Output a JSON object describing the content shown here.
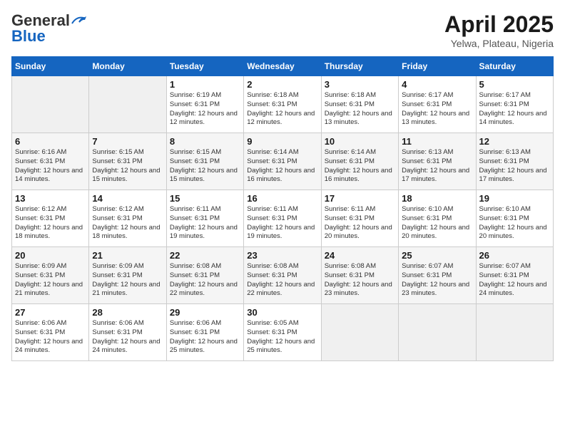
{
  "logo": {
    "general": "General",
    "blue": "Blue",
    "tagline": "GeneralBlue"
  },
  "calendar": {
    "title": "April 2025",
    "subtitle": "Yelwa, Plateau, Nigeria"
  },
  "headers": [
    "Sunday",
    "Monday",
    "Tuesday",
    "Wednesday",
    "Thursday",
    "Friday",
    "Saturday"
  ],
  "weeks": [
    [
      {
        "day": "",
        "sunrise": "",
        "sunset": "",
        "daylight": ""
      },
      {
        "day": "",
        "sunrise": "",
        "sunset": "",
        "daylight": ""
      },
      {
        "day": "1",
        "sunrise": "Sunrise: 6:19 AM",
        "sunset": "Sunset: 6:31 PM",
        "daylight": "Daylight: 12 hours and 12 minutes."
      },
      {
        "day": "2",
        "sunrise": "Sunrise: 6:18 AM",
        "sunset": "Sunset: 6:31 PM",
        "daylight": "Daylight: 12 hours and 12 minutes."
      },
      {
        "day": "3",
        "sunrise": "Sunrise: 6:18 AM",
        "sunset": "Sunset: 6:31 PM",
        "daylight": "Daylight: 12 hours and 13 minutes."
      },
      {
        "day": "4",
        "sunrise": "Sunrise: 6:17 AM",
        "sunset": "Sunset: 6:31 PM",
        "daylight": "Daylight: 12 hours and 13 minutes."
      },
      {
        "day": "5",
        "sunrise": "Sunrise: 6:17 AM",
        "sunset": "Sunset: 6:31 PM",
        "daylight": "Daylight: 12 hours and 14 minutes."
      }
    ],
    [
      {
        "day": "6",
        "sunrise": "Sunrise: 6:16 AM",
        "sunset": "Sunset: 6:31 PM",
        "daylight": "Daylight: 12 hours and 14 minutes."
      },
      {
        "day": "7",
        "sunrise": "Sunrise: 6:15 AM",
        "sunset": "Sunset: 6:31 PM",
        "daylight": "Daylight: 12 hours and 15 minutes."
      },
      {
        "day": "8",
        "sunrise": "Sunrise: 6:15 AM",
        "sunset": "Sunset: 6:31 PM",
        "daylight": "Daylight: 12 hours and 15 minutes."
      },
      {
        "day": "9",
        "sunrise": "Sunrise: 6:14 AM",
        "sunset": "Sunset: 6:31 PM",
        "daylight": "Daylight: 12 hours and 16 minutes."
      },
      {
        "day": "10",
        "sunrise": "Sunrise: 6:14 AM",
        "sunset": "Sunset: 6:31 PM",
        "daylight": "Daylight: 12 hours and 16 minutes."
      },
      {
        "day": "11",
        "sunrise": "Sunrise: 6:13 AM",
        "sunset": "Sunset: 6:31 PM",
        "daylight": "Daylight: 12 hours and 17 minutes."
      },
      {
        "day": "12",
        "sunrise": "Sunrise: 6:13 AM",
        "sunset": "Sunset: 6:31 PM",
        "daylight": "Daylight: 12 hours and 17 minutes."
      }
    ],
    [
      {
        "day": "13",
        "sunrise": "Sunrise: 6:12 AM",
        "sunset": "Sunset: 6:31 PM",
        "daylight": "Daylight: 12 hours and 18 minutes."
      },
      {
        "day": "14",
        "sunrise": "Sunrise: 6:12 AM",
        "sunset": "Sunset: 6:31 PM",
        "daylight": "Daylight: 12 hours and 18 minutes."
      },
      {
        "day": "15",
        "sunrise": "Sunrise: 6:11 AM",
        "sunset": "Sunset: 6:31 PM",
        "daylight": "Daylight: 12 hours and 19 minutes."
      },
      {
        "day": "16",
        "sunrise": "Sunrise: 6:11 AM",
        "sunset": "Sunset: 6:31 PM",
        "daylight": "Daylight: 12 hours and 19 minutes."
      },
      {
        "day": "17",
        "sunrise": "Sunrise: 6:11 AM",
        "sunset": "Sunset: 6:31 PM",
        "daylight": "Daylight: 12 hours and 20 minutes."
      },
      {
        "day": "18",
        "sunrise": "Sunrise: 6:10 AM",
        "sunset": "Sunset: 6:31 PM",
        "daylight": "Daylight: 12 hours and 20 minutes."
      },
      {
        "day": "19",
        "sunrise": "Sunrise: 6:10 AM",
        "sunset": "Sunset: 6:31 PM",
        "daylight": "Daylight: 12 hours and 20 minutes."
      }
    ],
    [
      {
        "day": "20",
        "sunrise": "Sunrise: 6:09 AM",
        "sunset": "Sunset: 6:31 PM",
        "daylight": "Daylight: 12 hours and 21 minutes."
      },
      {
        "day": "21",
        "sunrise": "Sunrise: 6:09 AM",
        "sunset": "Sunset: 6:31 PM",
        "daylight": "Daylight: 12 hours and 21 minutes."
      },
      {
        "day": "22",
        "sunrise": "Sunrise: 6:08 AM",
        "sunset": "Sunset: 6:31 PM",
        "daylight": "Daylight: 12 hours and 22 minutes."
      },
      {
        "day": "23",
        "sunrise": "Sunrise: 6:08 AM",
        "sunset": "Sunset: 6:31 PM",
        "daylight": "Daylight: 12 hours and 22 minutes."
      },
      {
        "day": "24",
        "sunrise": "Sunrise: 6:08 AM",
        "sunset": "Sunset: 6:31 PM",
        "daylight": "Daylight: 12 hours and 23 minutes."
      },
      {
        "day": "25",
        "sunrise": "Sunrise: 6:07 AM",
        "sunset": "Sunset: 6:31 PM",
        "daylight": "Daylight: 12 hours and 23 minutes."
      },
      {
        "day": "26",
        "sunrise": "Sunrise: 6:07 AM",
        "sunset": "Sunset: 6:31 PM",
        "daylight": "Daylight: 12 hours and 24 minutes."
      }
    ],
    [
      {
        "day": "27",
        "sunrise": "Sunrise: 6:06 AM",
        "sunset": "Sunset: 6:31 PM",
        "daylight": "Daylight: 12 hours and 24 minutes."
      },
      {
        "day": "28",
        "sunrise": "Sunrise: 6:06 AM",
        "sunset": "Sunset: 6:31 PM",
        "daylight": "Daylight: 12 hours and 24 minutes."
      },
      {
        "day": "29",
        "sunrise": "Sunrise: 6:06 AM",
        "sunset": "Sunset: 6:31 PM",
        "daylight": "Daylight: 12 hours and 25 minutes."
      },
      {
        "day": "30",
        "sunrise": "Sunrise: 6:05 AM",
        "sunset": "Sunset: 6:31 PM",
        "daylight": "Daylight: 12 hours and 25 minutes."
      },
      {
        "day": "",
        "sunrise": "",
        "sunset": "",
        "daylight": ""
      },
      {
        "day": "",
        "sunrise": "",
        "sunset": "",
        "daylight": ""
      },
      {
        "day": "",
        "sunrise": "",
        "sunset": "",
        "daylight": ""
      }
    ]
  ]
}
